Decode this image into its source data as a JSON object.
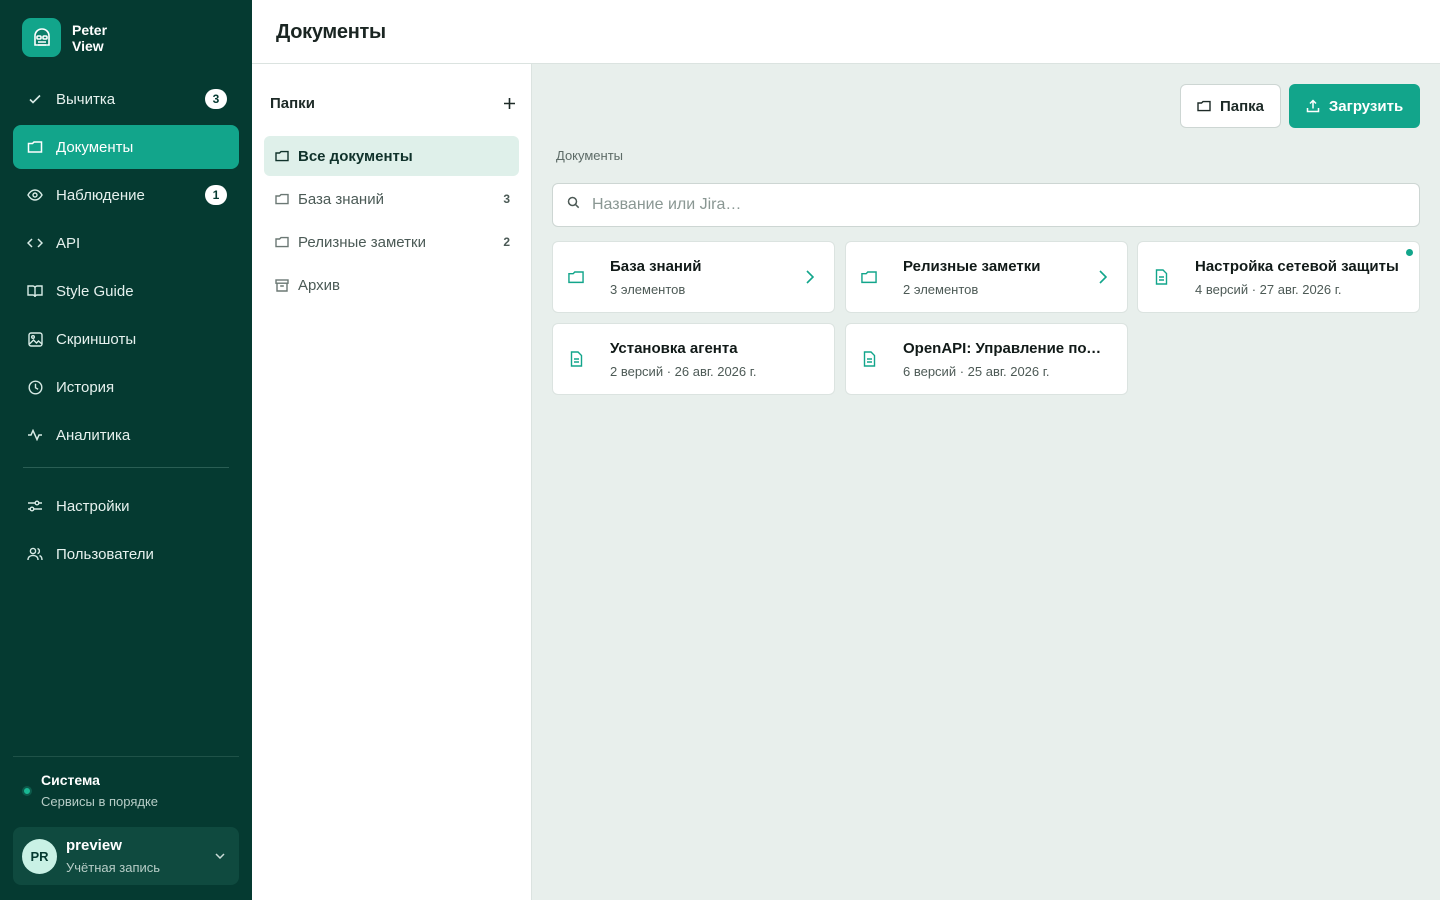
{
  "brand": {
    "line1": "Peter",
    "line2": "View"
  },
  "nav": {
    "items": [
      {
        "label": "Вычитка",
        "badge": "3",
        "icon": "check-icon"
      },
      {
        "label": "Документы",
        "badge": "",
        "icon": "folder-icon"
      },
      {
        "label": "Наблюдение",
        "badge": "1",
        "icon": "eye-icon"
      },
      {
        "label": "API",
        "badge": "",
        "icon": "code-icon"
      },
      {
        "label": "Style Guide",
        "badge": "",
        "icon": "book-icon"
      },
      {
        "label": "Скриншоты",
        "badge": "",
        "icon": "image-icon"
      },
      {
        "label": "История",
        "badge": "",
        "icon": "clock-icon"
      },
      {
        "label": "Аналитика",
        "badge": "",
        "icon": "activity-icon"
      }
    ],
    "bottom": [
      {
        "label": "Настройки",
        "icon": "sliders-icon"
      },
      {
        "label": "Пользователи",
        "icon": "users-icon"
      }
    ]
  },
  "system": {
    "title": "Система",
    "status": "Сервисы в порядке"
  },
  "account": {
    "initials": "PR",
    "name": "preview",
    "subtitle": "Учётная запись"
  },
  "header": {
    "title": "Документы"
  },
  "folders": {
    "title": "Папки",
    "items": [
      {
        "label": "Все документы",
        "count": ""
      },
      {
        "label": "База знаний",
        "count": "3"
      },
      {
        "label": "Релизные заметки",
        "count": "2"
      },
      {
        "label": "Архив",
        "count": ""
      }
    ]
  },
  "toolbar": {
    "folder_label": "Папка",
    "upload_label": "Загрузить"
  },
  "breadcrumb": "Документы",
  "search": {
    "placeholder": "Название или Jira…",
    "value": ""
  },
  "cards": [
    {
      "type": "folder",
      "title": "База знаний",
      "meta": "3 элементов"
    },
    {
      "type": "folder",
      "title": "Релизные заметки",
      "meta": "2 элементов"
    },
    {
      "type": "document",
      "title": "Настройка сетевой защиты",
      "meta": "4 версий · 27 авг. 2026 г."
    },
    {
      "type": "document",
      "title": "Установка агента",
      "meta": "2 версий · 26 авг. 2026 г."
    },
    {
      "type": "document",
      "title": "OpenAPI: Управление политиками",
      "meta": "6 версий · 25 авг. 2026 г."
    }
  ],
  "colors": {
    "sidebar": "#053a31",
    "accent": "#12a58b",
    "active_folder": "#dff0ea",
    "background": "#e8efec"
  }
}
